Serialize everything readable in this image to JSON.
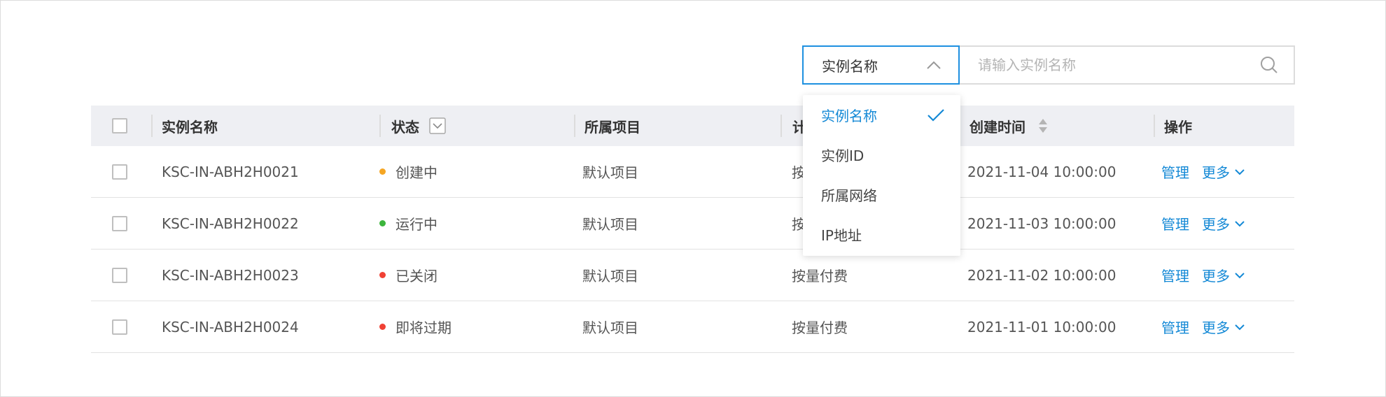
{
  "search": {
    "select_value": "实例名称",
    "placeholder": "请输入实例名称"
  },
  "dropdown": {
    "options": [
      "实例名称",
      "实例ID",
      "所属网络",
      "IP地址"
    ],
    "selected_index": 0
  },
  "table": {
    "headers": {
      "name": "实例名称",
      "status": "状态",
      "project": "所属项目",
      "billing": "计",
      "created": "创建时间",
      "actions": "操作"
    },
    "rows": [
      {
        "name": "KSC-IN-ABH2H0021",
        "status": "创建中",
        "status_color": "#f5a623",
        "project": "默认项目",
        "billing": "按",
        "created": "2021-11-04 10:00:00"
      },
      {
        "name": "KSC-IN-ABH2H0022",
        "status": "运行中",
        "status_color": "#3cb53c",
        "project": "默认项目",
        "billing": "按",
        "created": "2021-11-03 10:00:00"
      },
      {
        "name": "KSC-IN-ABH2H0023",
        "status": "已关闭",
        "status_color": "#f04134",
        "project": "默认项目",
        "billing": "按量付费",
        "created": "2021-11-02 10:00:00"
      },
      {
        "name": "KSC-IN-ABH2H0024",
        "status": "即将过期",
        "status_color": "#f04134",
        "project": "默认项目",
        "billing": "按量付费",
        "created": "2021-11-01 10:00:00"
      }
    ],
    "action_manage": "管理",
    "action_more": "更多"
  },
  "colors": {
    "accent": "#1489d6",
    "header_bg": "#eeeff3"
  }
}
